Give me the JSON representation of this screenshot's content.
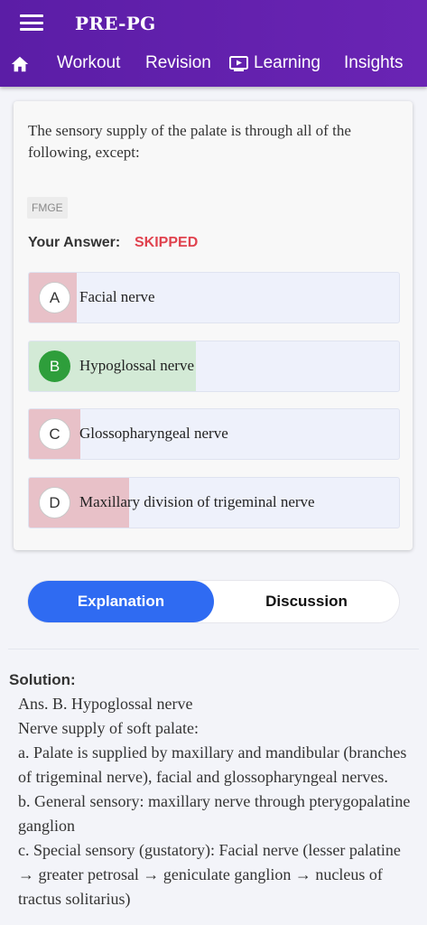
{
  "header": {
    "app_title": "PRE-PG",
    "nav": {
      "home_icon": "home-icon",
      "workout": "Workout",
      "revision": "Revision",
      "learning": "Learning",
      "learning_icon": "play-screen-icon",
      "insights": "Insights"
    },
    "color": "#5b1da6"
  },
  "question": {
    "text": "The sensory supply of the palate is through all of the following, except:",
    "tag": "FMGE",
    "your_answer_label": "Your Answer:",
    "your_answer_value": "SKIPPED",
    "options": [
      {
        "letter": "A",
        "text": "Facial nerve",
        "status": "wrong"
      },
      {
        "letter": "B",
        "text": "Hypoglossal nerve",
        "status": "correct"
      },
      {
        "letter": "C",
        "text": "Glossopharyngeal nerve",
        "status": "wrong"
      },
      {
        "letter": "D",
        "text": "Maxillary division of trigeminal nerve",
        "status": "wrong"
      }
    ]
  },
  "tabs": {
    "explanation": "Explanation",
    "discussion": "Discussion",
    "active": "Explanation",
    "active_color": "#2f6bf2"
  },
  "solution": {
    "title": "Solution:",
    "lines": [
      "Ans. B. Hypoglossal nerve",
      "Nerve supply of soft palate:",
      "a. Palate is supplied by maxillary and mandibular (branches of trigeminal nerve), facial and glossopharyngeal nerves.",
      "b. General sensory: maxillary nerve through pterygopalatine ganglion",
      "c. Special sensory (gustatory): Facial nerve (lesser palatine → greater petrosal → geniculate ganglion → nucleus of tractus solitarius)"
    ]
  }
}
